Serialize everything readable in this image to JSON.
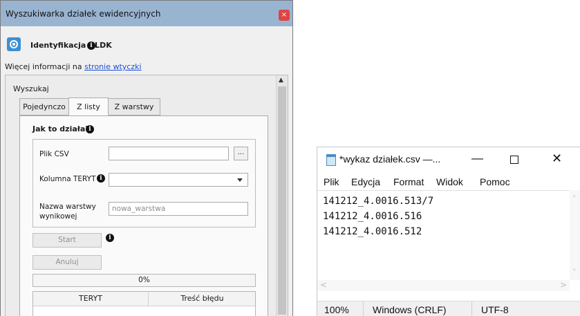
{
  "plugin_window": {
    "title": "Wyszukiwarka działek ewidencyjnych",
    "close_glyph": "×",
    "header": {
      "title": "Identyfikacja ULDK",
      "info_glyph": "i"
    },
    "more_info": {
      "prefix": "Więcej informacji na",
      "link": "stronie wtyczki"
    },
    "group_label": "Wyszukaj",
    "tabs": [
      {
        "label": "Pojedynczo",
        "active": false
      },
      {
        "label": "Z listy",
        "active": true
      },
      {
        "label": "Z warstwy",
        "active": false
      }
    ],
    "howto": "Jak to działa?",
    "form": {
      "csv_label": "Plik CSV",
      "csv_value": "",
      "browse_label": "...",
      "teryt_label": "Kolumna TERYT",
      "teryt_value": "",
      "layer_label_line1": "Nazwa warstwy",
      "layer_label_line2": "wynikowej",
      "layer_placeholder": "nowa_warstwa"
    },
    "start_label": "Start",
    "cancel_label": "Anuluj",
    "progress": {
      "text": "0%",
      "value": 0
    },
    "table": {
      "columns": [
        "TERYT",
        "Treść błędu"
      ],
      "rows": []
    }
  },
  "notepad_window": {
    "title": "*wykaz działek.csv —...",
    "controls": {
      "minimize": "—",
      "close": "✕"
    },
    "menu": [
      "Plik",
      "Edycja",
      "Format",
      "Widok",
      "Pomoc"
    ],
    "lines": [
      "141212_4.0016.513/7",
      "141212_4.0016.516",
      "141212_4.0016.512"
    ],
    "status": {
      "zoom": "100%",
      "line_endings": "Windows (CRLF)",
      "encoding": "UTF-8"
    }
  },
  "colors": {
    "title_bar": "#99b4d1",
    "close_button": "#e04343",
    "link": "#1a4fd6",
    "logo": "#3d8fd1"
  }
}
